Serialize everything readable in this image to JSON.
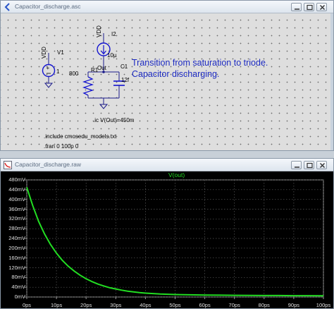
{
  "schematic_window": {
    "title": "Capacitor_discharge.asc",
    "components": {
      "vdd_label_1": "VDD",
      "v1_name": "V1",
      "v1_value": "1",
      "vdd_label_2": "VDD",
      "i2_name": "I2",
      "i2_value": "10µ",
      "r1_name": "R1",
      "r1_value": "800",
      "c1_name": "C1",
      "c1_value": "12f",
      "out_label": "Out"
    },
    "note_line1": "Transition from saturation to triode.",
    "note_line2": "Capacitor discharging.",
    "ic_directive": ".ic V(Out)=450m",
    "include_directive": ".include cmosedu_models.txt",
    "tran_directive": ".tran 0 100p 0"
  },
  "waveform_window": {
    "title": "Capacitor_discharge.raw",
    "trace_label": "V(out)",
    "trace_color": "#22dd22"
  },
  "colors": {
    "note_text": "#1d2bc2",
    "component_blue": "#1515d0",
    "wire": "#1c1c8a"
  },
  "chart_data": {
    "type": "line",
    "title": "V(out)",
    "xlabel": "",
    "ylabel": "",
    "x_tick_labels": [
      "0ps",
      "10ps",
      "20ps",
      "30ps",
      "40ps",
      "50ps",
      "60ps",
      "70ps",
      "80ps",
      "90ps",
      "100ps"
    ],
    "y_tick_labels": [
      "0mV",
      "40mV",
      "80mV",
      "120mV",
      "160mV",
      "200mV",
      "240mV",
      "280mV",
      "320mV",
      "360mV",
      "400mV",
      "440mV",
      "480mV"
    ],
    "xlim": [
      0,
      100
    ],
    "ylim": [
      0,
      480
    ],
    "grid": true,
    "series": [
      {
        "name": "V(out)",
        "x": [
          0,
          2,
          4,
          6,
          8,
          10,
          12,
          14,
          16,
          18,
          20,
          22,
          24,
          26,
          28,
          30,
          32,
          34,
          36,
          38,
          40,
          45,
          50,
          55,
          60,
          65,
          70,
          75,
          80,
          85,
          90,
          95,
          100
        ],
        "values": [
          450,
          375,
          310,
          258,
          215,
          180,
          150,
          126,
          106,
          89,
          75,
          63,
          53,
          45,
          38,
          33,
          28,
          24,
          21,
          18,
          16,
          12,
          10,
          9,
          8,
          7.5,
          7,
          6.5,
          6,
          6,
          5.5,
          5.5,
          5
        ]
      }
    ]
  }
}
